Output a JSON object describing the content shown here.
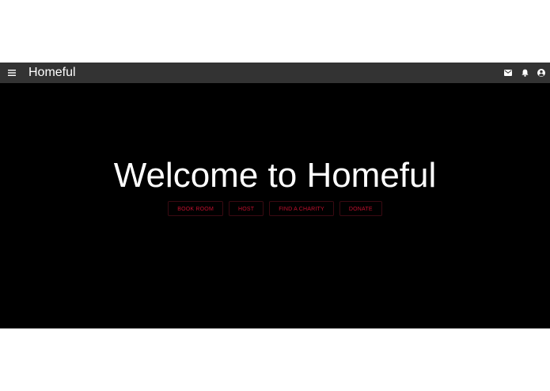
{
  "appbar": {
    "title": "Homeful",
    "menu_icon": "menu-icon",
    "actions": [
      {
        "icon": "mail-icon"
      },
      {
        "icon": "bell-icon"
      },
      {
        "icon": "account-circle-icon"
      }
    ]
  },
  "hero": {
    "title": "Welcome to Homeful",
    "buttons": [
      {
        "label": "BOOK ROOM"
      },
      {
        "label": "HOST"
      },
      {
        "label": "FIND A CHARITY"
      },
      {
        "label": "DONATE"
      }
    ]
  },
  "colors": {
    "appbar": "#333333",
    "background": "#000000",
    "accent": "#c2102e",
    "button_border": "#3a0a12"
  }
}
